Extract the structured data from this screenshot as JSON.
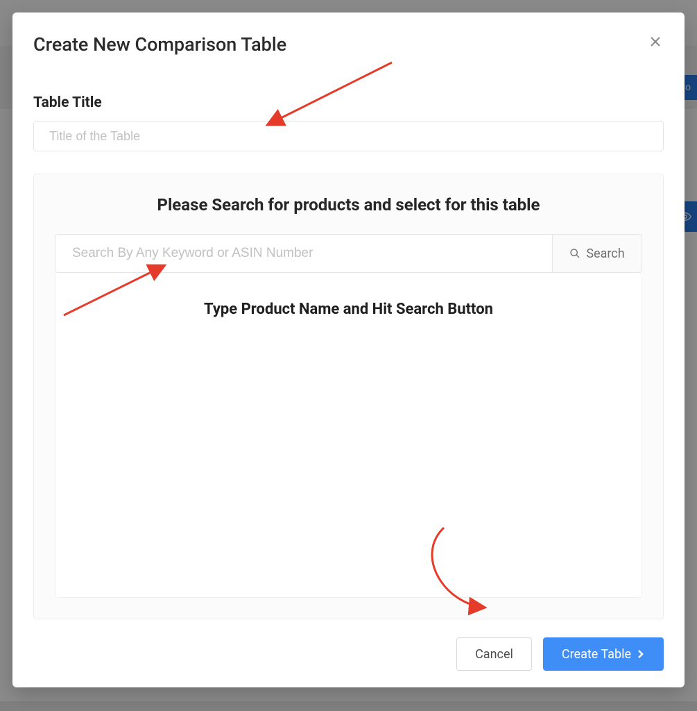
{
  "modal": {
    "title": "Create New Comparison Table",
    "title_field_label": "Table Title",
    "title_field_placeholder": "Title of the Table",
    "panel_heading": "Please Search for products and select for this table",
    "search_placeholder": "Search By Any Keyword or ASIN Number",
    "search_button_label": "Search",
    "results_hint": "Type Product Name and Hit Search Button",
    "cancel_label": "Cancel",
    "create_label": "Create Table"
  },
  "background": {
    "peek_button_1": "Co",
    "peek_button_2_icon": "eye-icon"
  }
}
